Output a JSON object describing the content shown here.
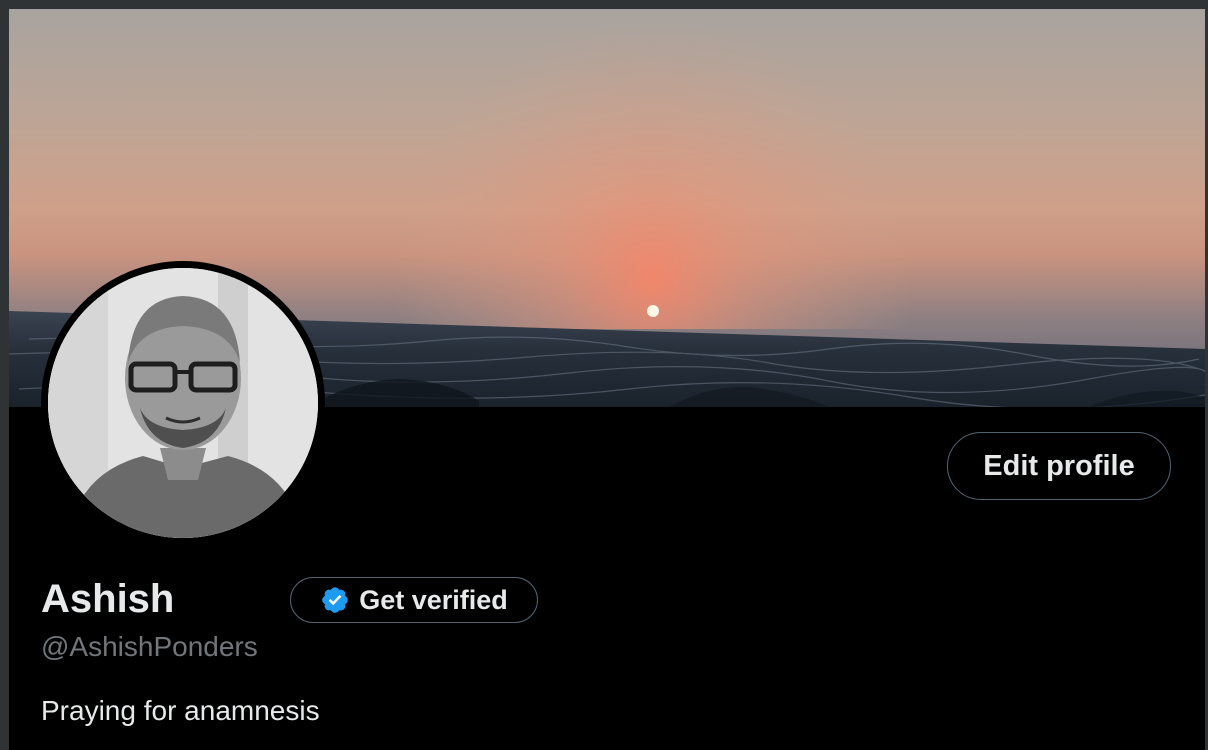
{
  "profile": {
    "display_name": "Ashish",
    "handle": "@AshishPonders",
    "bio": "Praying for anamnesis"
  },
  "actions": {
    "edit_profile_label": "Edit profile",
    "get_verified_label": "Get verified"
  },
  "icons": {
    "verified": "verified-badge-icon"
  },
  "colors": {
    "background": "#000000",
    "primary_text": "#e7e9ea",
    "secondary_text": "#71767b",
    "button_border": "#536471",
    "verified_blue": "#1d9bf0"
  }
}
